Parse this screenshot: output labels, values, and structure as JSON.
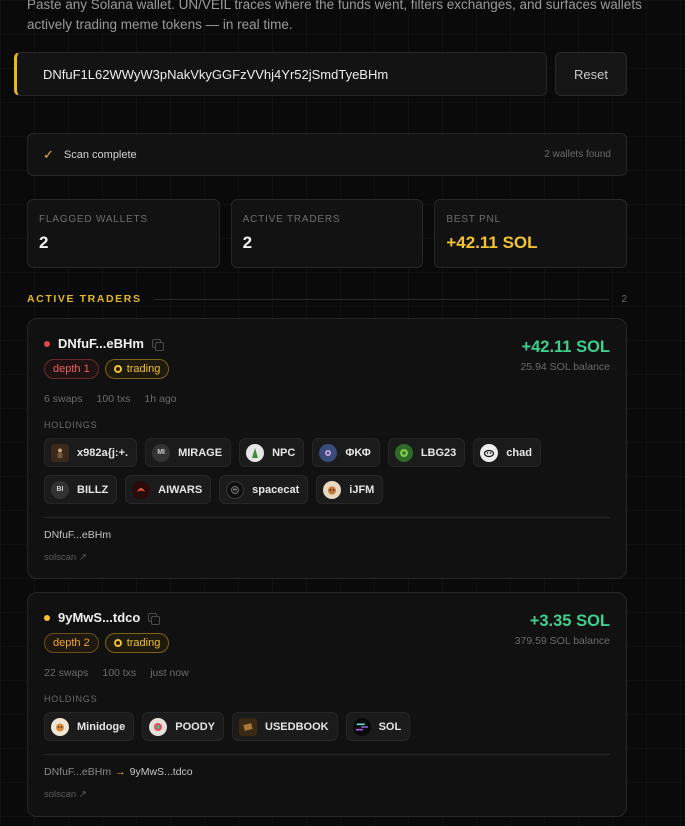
{
  "intro": "Paste any Solana wallet. UN/VEIL traces where the funds went, filters exchanges, and surfaces wallets actively trading meme tokens — in real time.",
  "search": {
    "value": "DNfuF1L62WWyW3pNakVkyGGFzVVhj4Yr52jSmdTyeBHm",
    "reset_label": "Reset"
  },
  "status": {
    "icon": "✓",
    "text": "Scan complete",
    "count": "2 wallets found"
  },
  "stats": [
    {
      "label": "Flagged wallets",
      "value": "2"
    },
    {
      "label": "Active traders",
      "value": "2"
    },
    {
      "label": "Best PnL",
      "value": "+42.11 SOL"
    }
  ],
  "section": {
    "title": "ACTIVE TRADERS",
    "count": "2"
  },
  "colors": {
    "accent": "#e8b820",
    "positive": "#3ecf8e",
    "danger": "#e04848"
  },
  "wallets": [
    {
      "name": "DNfuF...eBHm",
      "depth": "depth 1",
      "tag": "trading",
      "pnl": "+42.11 SOL",
      "balance": "25.94 SOL balance",
      "swaps": "6 swaps",
      "txs": "100 txs",
      "time": "1h ago",
      "holdings_label": "HOLDINGS",
      "tokens": [
        {
          "name": "x982a{j:+.",
          "icon": "dark-figure-icon"
        },
        {
          "name": "MIRAGE",
          "icon": "MI"
        },
        {
          "name": "NPC",
          "icon": "npc-icon"
        },
        {
          "name": "ΦΚΦ",
          "icon": "phi-icon"
        },
        {
          "name": "LBG23",
          "icon": "lbg-icon"
        },
        {
          "name": "chad",
          "icon": "chad-icon"
        },
        {
          "name": "BILLZ",
          "icon": "BI"
        },
        {
          "name": "AIWARS",
          "icon": "aiwars-icon"
        },
        {
          "name": "spacecat",
          "icon": "spacecat-icon"
        },
        {
          "name": "iJFM",
          "icon": "ijfm-icon"
        }
      ],
      "path": [
        "DNfuF...eBHm"
      ],
      "solscan": "solscan ↗"
    },
    {
      "name": "9yMwS...tdco",
      "depth": "depth 2",
      "tag": "trading",
      "pnl": "+3.35 SOL",
      "balance": "379.59 SOL balance",
      "swaps": "22 swaps",
      "txs": "100 txs",
      "time": "just now",
      "holdings_label": "HOLDINGS",
      "tokens": [
        {
          "name": "Minidoge",
          "icon": "minidoge-icon"
        },
        {
          "name": "POODY",
          "icon": "poody-icon"
        },
        {
          "name": "USEDBOOK",
          "icon": "book-icon"
        },
        {
          "name": "SOL",
          "icon": "sol-icon"
        }
      ],
      "path": [
        "DNfuF...eBHm",
        "→",
        "9yMwS...tdco"
      ],
      "solscan": "solscan ↗"
    }
  ]
}
